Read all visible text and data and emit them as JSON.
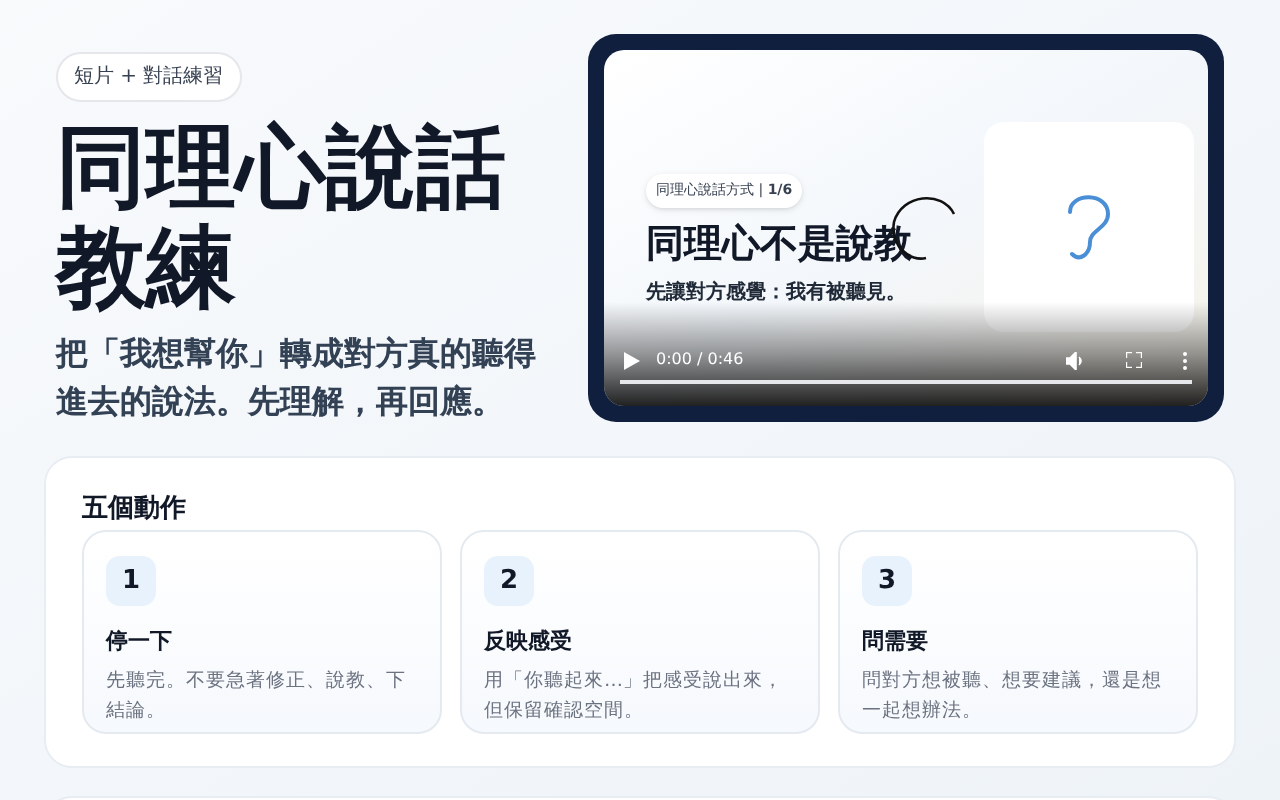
{
  "hero": {
    "badge": "短片 + 對話練習",
    "title_lines": [
      "同理心說話",
      "教練"
    ],
    "subtitle": "把「我想幫你」轉成對方真的聽得進去的說法。先理解，再回應。"
  },
  "video": {
    "slide_chip": "同理心說話方式 | **1/6**",
    "slide_title": "同理心不是說教",
    "slide_subtitle": "先讓對方感覺：我有被聽見。",
    "time": "0:00 / 0:46"
  },
  "actions": {
    "heading": "五個動作",
    "cards": [
      {
        "number": "1",
        "title": "停一下",
        "text": "先聽完。不要急著修正、說教、下結論。"
      },
      {
        "number": "2",
        "title": "反映感受",
        "text": "用「你聽起來…」把感受說出來，但保留確認空間。"
      },
      {
        "number": "3",
        "title": "問需要",
        "text": "問對方想被聽、想要建議，還是想一起想辦法。"
      }
    ]
  }
}
